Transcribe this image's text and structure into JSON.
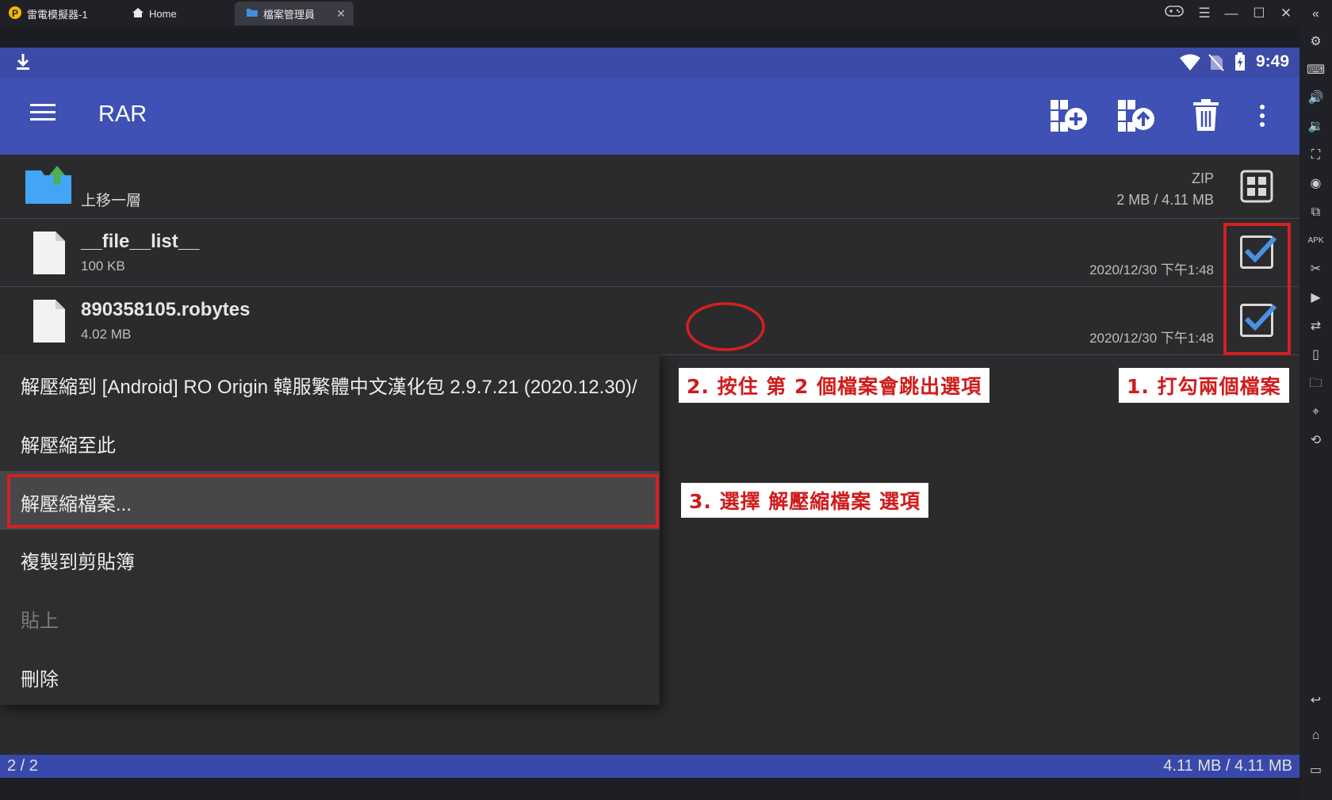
{
  "emulator": {
    "tabs": [
      {
        "label": "雷電模擬器-1",
        "icon": "ldplayer-logo-icon"
      },
      {
        "label": "Home",
        "icon": "home-icon"
      },
      {
        "label": "檔案管理員",
        "icon": "folder-icon"
      }
    ],
    "sidebar_icons": [
      "settings-icon",
      "keyboard-icon",
      "volume-up-icon",
      "volume-down-icon",
      "screenshot-icon",
      "record-icon",
      "multi-instance-icon",
      "apk-icon",
      "scissors-icon",
      "video-icon",
      "sync-icon",
      "shake-icon",
      "folder-icon",
      "location-icon",
      "rotate-icon",
      "back-icon",
      "home-icon",
      "recents-icon"
    ]
  },
  "status": {
    "time": "9:49"
  },
  "appbar": {
    "title": "RAR"
  },
  "parent_row": {
    "label": "上移一層",
    "type": "ZIP",
    "size": "2 MB / 4.11 MB"
  },
  "files": [
    {
      "name": "__file__list__",
      "size": "100 KB",
      "date": "2020/12/30 下午1:48",
      "checked": true
    },
    {
      "name": "890358105.robytes",
      "size": "4.02 MB",
      "date": "2020/12/30 下午1:48",
      "checked": true
    }
  ],
  "menu": {
    "items": [
      {
        "label": "解壓縮到 [Android] RO Origin 韓服繁體中文漢化包 2.9.7.21 (2020.12.30)/",
        "enabled": true
      },
      {
        "label": "解壓縮至此",
        "enabled": true
      },
      {
        "label": "解壓縮檔案...",
        "enabled": true,
        "highlighted": true
      },
      {
        "label": "複製到剪貼簿",
        "enabled": true
      },
      {
        "label": "貼上",
        "enabled": false
      },
      {
        "label": "刪除",
        "enabled": true
      }
    ]
  },
  "annotations": {
    "step1": "1. 打勾兩個檔案",
    "step2": "2. 按住 第 2 個檔案會跳出選項",
    "step3": "3. 選擇 解壓縮檔案 選項",
    "color": "#d42020"
  },
  "footer": {
    "selection": "2 / 2",
    "total": "4.11 MB / 4.11 MB"
  },
  "colors": {
    "appbar": "#3f51b5",
    "footer": "#3949ab",
    "checkmark": "#4a90e2"
  }
}
